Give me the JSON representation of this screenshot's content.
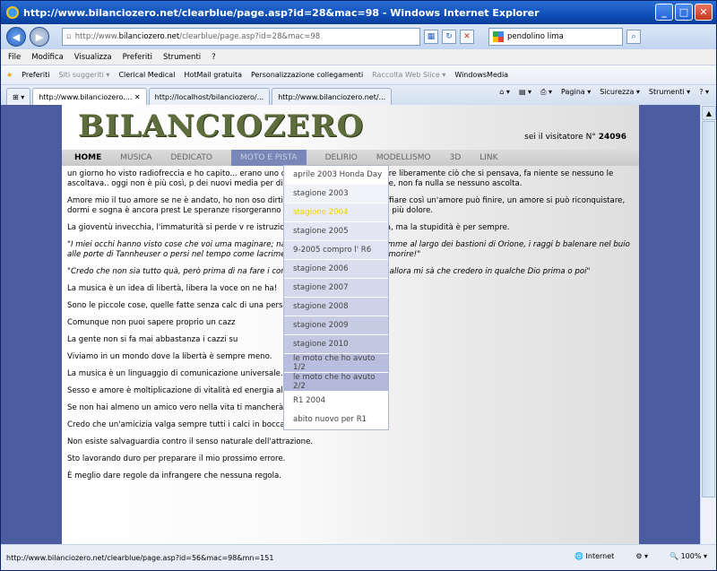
{
  "window": {
    "title": "http://www.bilanciozero.net/clearblue/page.asp?id=28&mac=98 - Windows Internet Explorer"
  },
  "address": {
    "prefix": "http://www.",
    "domain": "bilanciozero.net",
    "path": "/clearblue/page.asp?id=28&mac=98"
  },
  "search": {
    "value": "pendolino lima"
  },
  "menu": [
    "File",
    "Modifica",
    "Visualizza",
    "Preferiti",
    "Strumenti",
    "?"
  ],
  "favorites": {
    "label": "Preferiti",
    "items": [
      "Siti suggeriti ▾",
      "Clerical Medical",
      "HotMail gratuita",
      "Personalizzazione collegamenti",
      "Raccolta Web Slice ▾",
      "WindowsMedia"
    ]
  },
  "tabs": [
    "http://www.bilanciozero.... ✕",
    "http://localhost/bilanciozero/...",
    "http://www.bilanciozero.net/..."
  ],
  "tabtools": [
    "Pagina ▾",
    "Sicurezza ▾",
    "Strumenti ▾"
  ],
  "site": {
    "logo": "BILANCIOZERO",
    "visitor_text": "sei il visitatore N°",
    "visitor_count": "24096"
  },
  "nav": [
    "HOME",
    "MUSICA",
    "DEDICATO",
    "MOTO E PISTA",
    "DELIRIO",
    "MODELLISMO",
    "3D",
    "LINK"
  ],
  "dropdown": [
    "aprile 2003 Honda Day",
    "stagione 2003",
    "stagione 2004",
    "stagione 2005",
    "9-2005 compro l' R6",
    "stagione 2006",
    "stagione 2007",
    "stagione 2008",
    "stagione 2009",
    "stagione 2010",
    "le moto che ho avuto 1/2",
    "le moto che ho avuto 2/2",
    "R1 2004",
    "abito nuovo per R1"
  ],
  "paragraphs": [
    "un giorno ho visto radiofreccia e ho capito... erano uno degli strumenti per esprimere liberamente ciò che si pensava, fa niente se nessuno le ascoltava.. oggi non è più così, p dei nuovi media per dire ciò che si ha voglia di dire, non fa nulla se nessuno ascolta.",
    "Amore mio il tuo amore se ne è andato, ho non oso dirti che come il vento deve soffiare così un'amore può finire, un amore si può riconquistare, dormi e sogna è ancora prest Le speranze risorgeranno e allora da questa va senza più dolore.",
    "La gioventù invecchia, l'immaturità si perde v re istruzione, e l'ubriachezza sobrietà, ma la stupidità è per sempre.",
    "\"I miei occhi hanno visto cose che voi uma maginare; navi da combattimento in fiamme al largo dei bastioni di Orione, i raggi b balenare nel buio alle porte di Tannheuser o persi nel tempo come lacrime nella pioggia. E' tempo di morire!\"",
    "\"Credo che non sia tutto quà, però prima di na fare i conti con quello che c'è quà e allora mi sà che credero in qualche Dio prima o poi\"",
    "La musica è un idea di libertà, libera la voce on ne ha!",
    "Sono le piccole cose, quelle fatte senza calc di una persona.",
    "Comunque non puoi sapere proprio un cazz",
    "La gente non si fa mai abbastanza i cazzi su",
    "Viviamo in un mondo dove la libertà è sempre meno.",
    "La musica è un linguaggio di comunicazione universale.",
    "Sesso e amore è moltiplicazione di vitalità ed energia allo stato puro.",
    "Se non hai almeno un amico vero nella vita ti mancherà sempre qualcosa.",
    "Credo che un'amicizia valga sempre tutti i calci in bocca che prendi per trovarla.",
    "Non esiste salvaguardia contro il senso naturale dell'attrazione.",
    "Sto lavorando duro per preparare il mio prossimo errore.",
    "È meglio dare regole da infrangere che nessuna regola."
  ],
  "status": {
    "url": "http://www.bilanciozero.net/clearblue/page.asp?id=56&mac=98&mn=151",
    "zone": "Internet",
    "zoom": "100%"
  }
}
